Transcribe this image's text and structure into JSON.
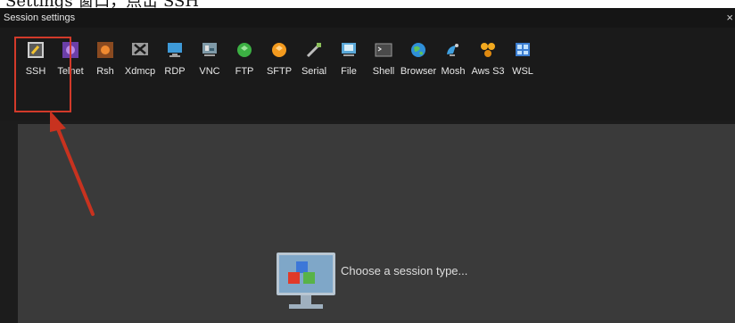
{
  "page_heading_fragment": "Settings 窗口，点击 SSH",
  "window": {
    "title": "Session settings",
    "close_glyph": "×"
  },
  "session_types": [
    {
      "label": "SSH",
      "icon": "ssh-key-icon"
    },
    {
      "label": "Telnet",
      "icon": "telnet-icon"
    },
    {
      "label": "Rsh",
      "icon": "rsh-icon"
    },
    {
      "label": "Xdmcp",
      "icon": "xdmcp-icon"
    },
    {
      "label": "RDP",
      "icon": "rdp-monitor-icon"
    },
    {
      "label": "VNC",
      "icon": "vnc-icon"
    },
    {
      "label": "FTP",
      "icon": "ftp-globe-icon"
    },
    {
      "label": "SFTP",
      "icon": "sftp-globe-icon"
    },
    {
      "label": "Serial",
      "icon": "serial-plug-icon"
    },
    {
      "label": "File",
      "icon": "file-icon"
    },
    {
      "label": "Shell",
      "icon": "shell-terminal-icon"
    },
    {
      "label": "Browser",
      "icon": "browser-globe-icon"
    },
    {
      "label": "Mosh",
      "icon": "mosh-satellite-icon"
    },
    {
      "label": "Aws S3",
      "icon": "aws-s3-icon"
    },
    {
      "label": "WSL",
      "icon": "wsl-window-icon"
    }
  ],
  "selected_session": "SSH",
  "content": {
    "prompt": "Choose a session type..."
  },
  "colors": {
    "highlight": "#d23a2a",
    "toolbar_bg": "#1a1a1a",
    "content_bg": "#3a3a3a"
  }
}
